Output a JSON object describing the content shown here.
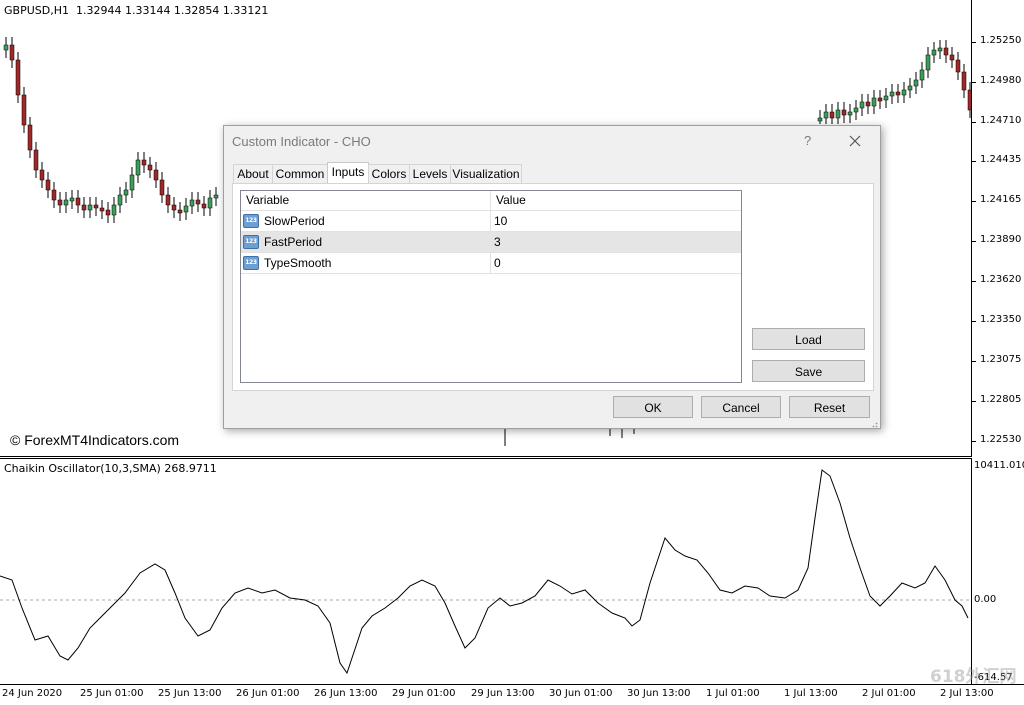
{
  "main_chart": {
    "header": "GBPUSD,H1  1.32944 1.33144 1.32854 1.33121",
    "price_labels": [
      "1.25250",
      "1.24980",
      "1.24710",
      "1.24435",
      "1.24165",
      "1.23890",
      "1.23620",
      "1.23350",
      "1.23075",
      "1.22805",
      "1.22530"
    ],
    "watermark": "© ForexMT4Indicators.com",
    "colors": {
      "bull": "#3c9e5a",
      "bear": "#a02828",
      "wick": "#000000"
    }
  },
  "indicator": {
    "header": "Chaikin Oscillator(10,3,SMA) 268.9711",
    "top_label": "10411.010",
    "zero_label": "0.00",
    "bottom_label": "-614.57"
  },
  "time_axis": [
    "24 Jun 2020",
    "25 Jun 01:00",
    "25 Jun 13:00",
    "26 Jun 01:00",
    "26 Jun 13:00",
    "29 Jun 01:00",
    "29 Jun 13:00",
    "30 Jun 01:00",
    "30 Jun 13:00",
    "1 Jul 01:00",
    "1 Jul 13:00",
    "2 Jul 01:00",
    "2 Jul 13:00"
  ],
  "corner_watermark": "618外汇网",
  "dialog": {
    "title": "Custom Indicator - CHO",
    "help": "?",
    "tabs": [
      "About",
      "Common",
      "Inputs",
      "Colors",
      "Levels",
      "Visualization"
    ],
    "active_tab": "Inputs",
    "table": {
      "col_variable": "Variable",
      "col_value": "Value",
      "rows": [
        {
          "icon": "123",
          "variable": "SlowPeriod",
          "value": "10"
        },
        {
          "icon": "123",
          "variable": "FastPeriod",
          "value": "3"
        },
        {
          "icon": "123",
          "variable": "TypeSmooth",
          "value": "0"
        }
      ]
    },
    "load_label": "Load",
    "save_label": "Save",
    "ok_label": "OK",
    "cancel_label": "Cancel",
    "reset_label": "Reset"
  }
}
